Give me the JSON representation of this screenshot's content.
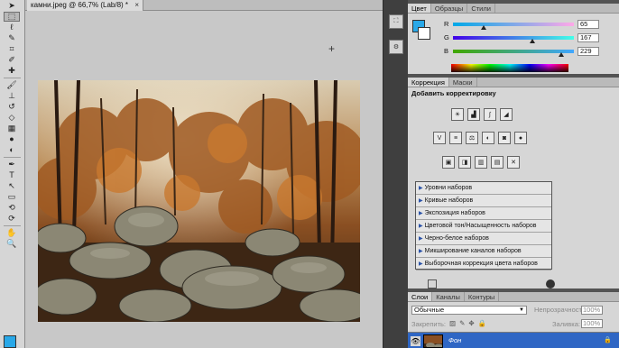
{
  "document": {
    "tab_title": "камни.jpeg @ 66,7% (Lab/8) *",
    "close_glyph": "×"
  },
  "tools": [
    {
      "name": "move-tool-icon",
      "glyph": "➤"
    },
    {
      "name": "marquee-tool-icon",
      "glyph": "⬚"
    },
    {
      "name": "lasso-tool-icon",
      "glyph": "ℓ"
    },
    {
      "name": "quick-select-tool-icon",
      "glyph": "✎"
    },
    {
      "name": "crop-tool-icon",
      "glyph": "⌗"
    },
    {
      "name": "eyedropper-tool-icon",
      "glyph": "✐"
    },
    {
      "name": "healing-brush-tool-icon",
      "glyph": "✚"
    },
    {
      "name": "brush-tool-icon",
      "glyph": "🖌"
    },
    {
      "name": "clone-stamp-tool-icon",
      "glyph": "⊥"
    },
    {
      "name": "history-brush-tool-icon",
      "glyph": "↺"
    },
    {
      "name": "eraser-tool-icon",
      "glyph": "◇"
    },
    {
      "name": "gradient-tool-icon",
      "glyph": "▦"
    },
    {
      "name": "blur-tool-icon",
      "glyph": "●"
    },
    {
      "name": "dodge-tool-icon",
      "glyph": "◐"
    },
    {
      "name": "pen-tool-icon",
      "glyph": "✒"
    },
    {
      "name": "type-tool-icon",
      "glyph": "T"
    },
    {
      "name": "path-select-tool-icon",
      "glyph": "↖"
    },
    {
      "name": "shape-tool-icon",
      "glyph": "▭"
    },
    {
      "name": "3d-rotate-tool-icon",
      "glyph": "⟲"
    },
    {
      "name": "3d-orbit-tool-icon",
      "glyph": "⟳"
    },
    {
      "name": "hand-tool-icon",
      "glyph": "✋"
    },
    {
      "name": "zoom-tool-icon",
      "glyph": "🔍"
    }
  ],
  "dock": {
    "button1": "⛶",
    "button2": "⚙"
  },
  "color_panel": {
    "tabs": [
      "Цвет",
      "Образцы",
      "Стили"
    ],
    "channels": [
      {
        "label": "R",
        "value": "65",
        "fraction": 0.255,
        "gradient": "linear-gradient(90deg,#00a8e8,#ffa8e8)"
      },
      {
        "label": "G",
        "value": "167",
        "fraction": 0.655,
        "gradient": "linear-gradient(90deg,#4100e8,#41ffe8)"
      },
      {
        "label": "B",
        "value": "229",
        "fraction": 0.898,
        "gradient": "linear-gradient(90deg,#41a700,#41a7ff)"
      }
    ],
    "foreground_color": "#29a8e8",
    "background_color": "#ffffff"
  },
  "adjustments": {
    "tabs": [
      "Коррекция",
      "Маски"
    ],
    "title": "Добавить корректировку",
    "icon_rows": [
      [
        "brightness-icon",
        "levels-icon",
        "curves-icon",
        "exposure-icon"
      ],
      [
        "vibrance-icon",
        "hue-saturation-icon",
        "color-balance-icon",
        "black-white-icon",
        "photo-filter-icon",
        "channel-mixer-icon"
      ],
      [
        "invert-icon",
        "posterize-icon",
        "threshold-icon",
        "gradient-map-icon",
        "selective-color-icon"
      ]
    ],
    "icon_glyphs": [
      [
        "☀",
        "▟",
        "∫",
        "◢"
      ],
      [
        "V",
        "≡",
        "⚖",
        "◐",
        "◙",
        "●"
      ],
      [
        "▣",
        "◨",
        "▥",
        "▤",
        "✕"
      ]
    ],
    "presets": [
      "Уровни наборов",
      "Кривые наборов",
      "Экспозиция наборов",
      "Цветовой тон/Насыщенность наборов",
      "Черно-белое наборов",
      "Микширование каналов наборов",
      "Выборочная коррекция цвета наборов"
    ]
  },
  "layers_panel": {
    "tabs": [
      "Слои",
      "Каналы",
      "Контуры"
    ],
    "blend_mode": "Обычные",
    "opacity_label": "Непрозрачность:",
    "opacity_value": "100%",
    "lock_label": "Закрепить:",
    "fill_label": "Заливка:",
    "fill_value": "100%",
    "layer_name": "Фон",
    "layer_lock_glyph": "🔒",
    "eye_glyph": "👁"
  }
}
